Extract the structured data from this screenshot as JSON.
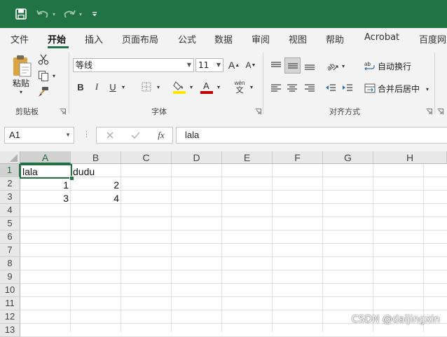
{
  "quick_access": {
    "save_icon": "save-icon",
    "undo_icon": "undo-icon",
    "redo_icon": "redo-icon",
    "customize_icon": "customize-qat-icon"
  },
  "tabs": [
    {
      "label": "文件"
    },
    {
      "label": "开始",
      "active": true
    },
    {
      "label": "插入"
    },
    {
      "label": "页面布局"
    },
    {
      "label": "公式"
    },
    {
      "label": "数据"
    },
    {
      "label": "审阅"
    },
    {
      "label": "视图"
    },
    {
      "label": "帮助"
    },
    {
      "label": "Acrobat"
    },
    {
      "label": "百度网"
    }
  ],
  "ribbon": {
    "clipboard": {
      "paste_label": "粘贴",
      "group_label": "剪贴板"
    },
    "font": {
      "font_name": "等线",
      "font_size": "11",
      "group_label": "字体",
      "bold": "B",
      "italic": "I",
      "underline": "U",
      "grow_font": "A",
      "shrink_font": "A",
      "phonetic_top": "wén",
      "phonetic_bottom": "文",
      "font_color": "#c00000",
      "fill_color": "#ffe600"
    },
    "alignment": {
      "wrap_text": "自动换行",
      "merge_center": "合并后居中",
      "group_label": "对齐方式"
    }
  },
  "formula_bar": {
    "name_box": "A1",
    "cancel_icon": "cancel-icon",
    "enter_icon": "enter-icon",
    "fx_label": "fx",
    "value": "lala"
  },
  "sheet": {
    "columns": [
      "A",
      "B",
      "C",
      "D",
      "E",
      "F",
      "G",
      "H"
    ],
    "rows": [
      "1",
      "2",
      "3",
      "4",
      "5",
      "6",
      "7",
      "8",
      "9",
      "10",
      "11",
      "12",
      "13"
    ],
    "active_cell": "A1",
    "cells": {
      "A1": "lala",
      "B1": "dudu",
      "A2": "1",
      "B2": "2",
      "A3": "3",
      "B3": "4"
    }
  },
  "watermark": "CSDN @daijingxin",
  "colors": {
    "accent": "#217346"
  }
}
